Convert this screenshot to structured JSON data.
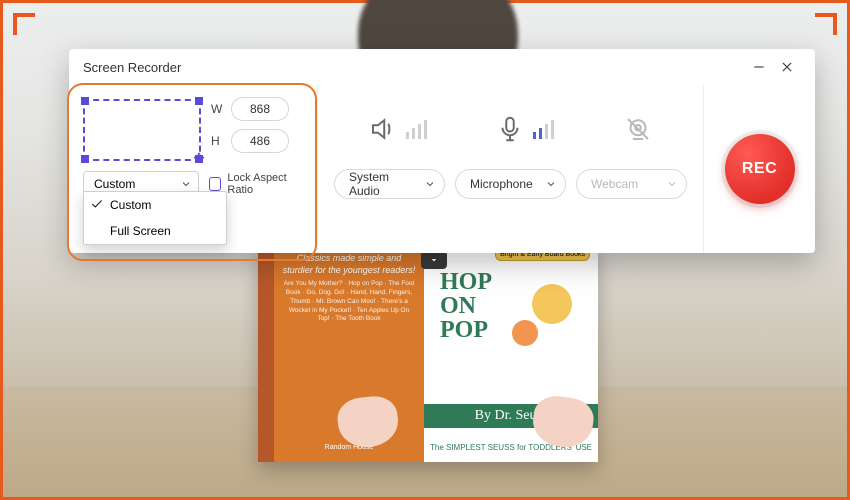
{
  "window": {
    "title": "Screen Recorder"
  },
  "region": {
    "width_label": "W",
    "height_label": "H",
    "width_value": "868",
    "height_value": "486",
    "mode_selected": "Custom",
    "mode_options": [
      "Custom",
      "Full Screen"
    ],
    "lock_aspect_label": "Lock Aspect Ratio"
  },
  "sources": {
    "system_audio": {
      "label": "System Audio"
    },
    "microphone": {
      "label": "Microphone"
    },
    "webcam": {
      "label": "Webcam"
    }
  },
  "record": {
    "button_label": "REC"
  },
  "background_book": {
    "tagline": "Classics made simple and sturdier for the youngest readers!",
    "publisher": "Random House",
    "badge": "Bright & Early Board Books",
    "title_line1": "HOP",
    "title_line2": "ON",
    "title_line3": "POP",
    "author_prefix": "By",
    "author": "Dr. Seuss",
    "subtitle": "The SIMPLEST SEUSS for TODDLERS' USE"
  }
}
